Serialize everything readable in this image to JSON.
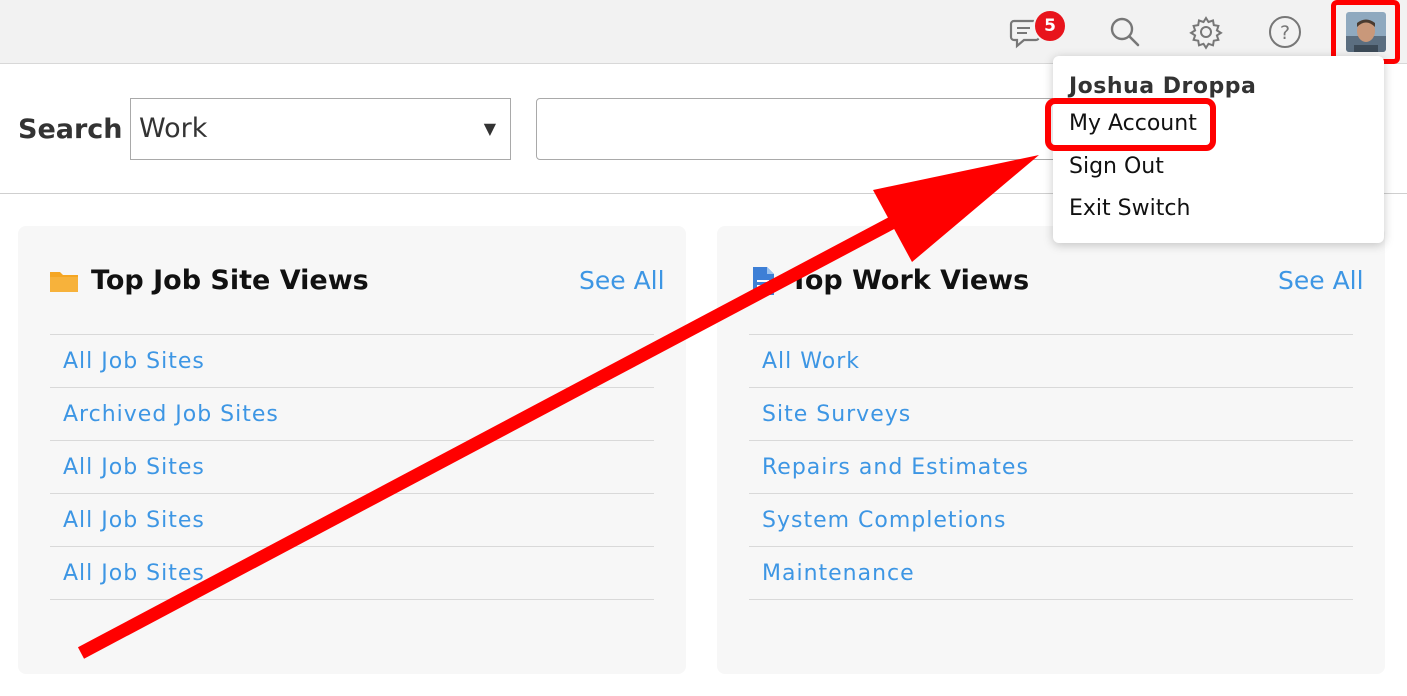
{
  "topbar": {
    "messages_icon": "chat-bubble-icon",
    "notification_count": "5",
    "search_icon": "search-icon",
    "settings_icon": "gear-icon",
    "help_icon": "help-circle-icon",
    "highlight_color": "#ff0000"
  },
  "search": {
    "label": "Search",
    "select_value": "Work",
    "input_value": ""
  },
  "cards": [
    {
      "title": "Top Job Site Views",
      "icon": "folder-icon",
      "see_all": "See All",
      "items": [
        "All Job Sites",
        "Archived Job Sites",
        "All Job Sites",
        "All Job Sites",
        "All Job Sites"
      ]
    },
    {
      "title": "Top Work Views",
      "icon": "document-icon",
      "see_all": "See All",
      "items": [
        "All Work",
        "Site Surveys",
        "Repairs and Estimates",
        "System Completions",
        "Maintenance"
      ]
    }
  ],
  "user_menu": {
    "name": "Joshua Droppa",
    "items": [
      "My Account",
      "Sign Out",
      "Exit Switch"
    ]
  },
  "colors": {
    "link": "#3d96e4",
    "badge": "#e8141c",
    "annotation": "#ff0000",
    "folder": "#f5a623",
    "document": "#3d7fd6"
  }
}
